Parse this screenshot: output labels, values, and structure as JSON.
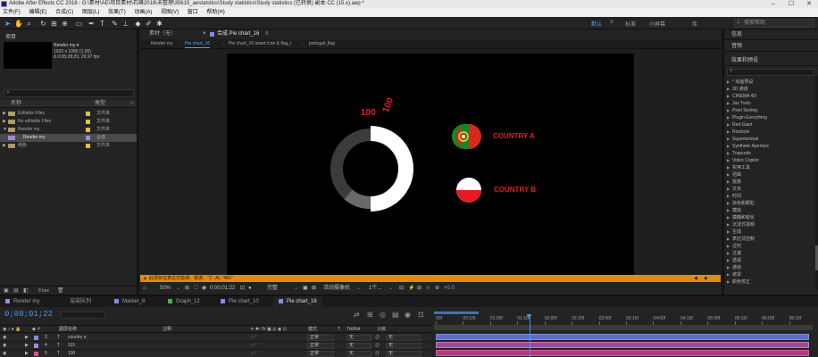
{
  "window": {
    "title": "Adobe After Effects CC 2018 - G:\\素材\\AE\\项目素材\\石峰2018\\未整理\\35615_aestatstics\\Study statistics\\Study statistics (已转换) 副本 CC (15.x).aep *",
    "minimize": "–",
    "maximize": "☐",
    "close": "✕"
  },
  "menu": [
    "文件(F)",
    "编辑(E)",
    "合成(C)",
    "图层(L)",
    "效果(T)",
    "动画(A)",
    "视图(V)",
    "窗口",
    "帮助(H)"
  ],
  "toolbar": {
    "workspaces": [
      "默认",
      "≡",
      "标准",
      "小屏幕",
      "库"
    ],
    "active_workspace": "默认",
    "search_placeholder": "搜索帮助"
  },
  "project": {
    "tab": "项目",
    "selected_name": "Render my ▾",
    "meta": [
      "1920 x 1080 (1.00)",
      "Δ 0;05;28;29, 29.97 fps"
    ],
    "search_placeholder": "",
    "columns": [
      "名称",
      "类型"
    ],
    "rows": [
      {
        "name": "Editable Files",
        "type": "文件夹",
        "kind": "folder",
        "color": "#d7c24a",
        "selected": false
      },
      {
        "name": "No editable Files",
        "type": "文件夹",
        "kind": "folder",
        "color": "#d7c24a",
        "selected": false
      },
      {
        "name": "Render my",
        "type": "文件夹",
        "kind": "folder",
        "color": "#d7c24a",
        "selected": false
      },
      {
        "name": "Render my",
        "type": "合成",
        "kind": "comp",
        "color": "#9a8cdc",
        "selected": true
      },
      {
        "name": "纯色",
        "type": "文件夹",
        "kind": "folder",
        "color": "#d7c24a",
        "selected": false
      }
    ],
    "bpc": "8 bpc"
  },
  "composition": {
    "tabs": [
      "素材（无）",
      "合成 Pie chart_16"
    ],
    "active_tab": "合成 Pie chart_16",
    "breadcrumbs": [
      "Render my",
      "Pie chart_16",
      "Pie chart_16 insert icon & flag_i",
      "portugal_flag"
    ],
    "status": "此项目在表达式错误：错误：\"1\", At, \"456\"",
    "viewer": {
      "zoom": "50%",
      "timecode": "0;00;01;22",
      "resolution": "完整",
      "camera": "活动摄像机",
      "views": "1个...",
      "exposure": "+0.0"
    },
    "canvas": {
      "label_100_a": "100",
      "label_100_b": "100",
      "country_a": "COUNTRY A",
      "country_b": "COUNTRY B"
    }
  },
  "effects": {
    "info_tab": "信息",
    "audio_tab": "音频",
    "presets_tab": "效果和预设",
    "search_placeholder": "",
    "items": [
      "* 动画预设",
      "3D 通道",
      "CINEMA 4D",
      "Jax Tools",
      "Pixel Sorting",
      "Plugin Everything",
      "Red Giant",
      "Rowbyte",
      "Superluminal",
      "Synthetic Aperture",
      "Trapcode",
      "Video Copilot",
      "实用工具",
      "扭曲",
      "抠像",
      "文本",
      "时间",
      "杂色和颗粒",
      "模拟",
      "模糊和锐化",
      "沉浸式视频",
      "生成",
      "表达式控制",
      "过时",
      "过渡",
      "透视",
      "通道",
      "遮罩",
      "颜色校正"
    ]
  },
  "timeline": {
    "tabs": [
      {
        "label": "Render my",
        "color": "#9a8cdc"
      },
      {
        "label": "渲染队列",
        "color": ""
      },
      {
        "label": "Marker_8",
        "color": "#7a8ef0"
      },
      {
        "label": "Graph_12",
        "color": "#4caf50"
      },
      {
        "label": "Pie chart_10",
        "color": "#7a8ef0"
      },
      {
        "label": "Pie chart_16",
        "color": "#7a8ef0"
      }
    ],
    "active_tab": "Pie chart_16",
    "timecode": "0;00;01;22",
    "headers": [
      "图层名称",
      "注释",
      "模式",
      "T",
      "TrkMat",
      "父级"
    ],
    "layers": [
      {
        "num": "3",
        "type": "T",
        "name": "country a",
        "mode": "正常",
        "trkmat": "无",
        "parent": "无",
        "color": "#7a8ef0"
      },
      {
        "num": "4",
        "type": "T",
        "name": "101",
        "mode": "正常",
        "trkmat": "无",
        "parent": "无",
        "color": "#9a8cdc"
      },
      {
        "num": "5",
        "type": "T",
        "name": "100",
        "mode": "正常",
        "trkmat": "无",
        "parent": "无",
        "color": "#e04aa0"
      }
    ],
    "ruler": [
      "00f",
      "00:15f",
      "01:00f",
      "01:15f",
      "02:00f",
      "02:15f",
      "03:00f",
      "03:15f",
      "04:00f",
      "04:15f",
      "05:00f",
      "05:15f",
      "06:00f",
      "06:15f"
    ],
    "current_time_fraction": 0.25
  }
}
